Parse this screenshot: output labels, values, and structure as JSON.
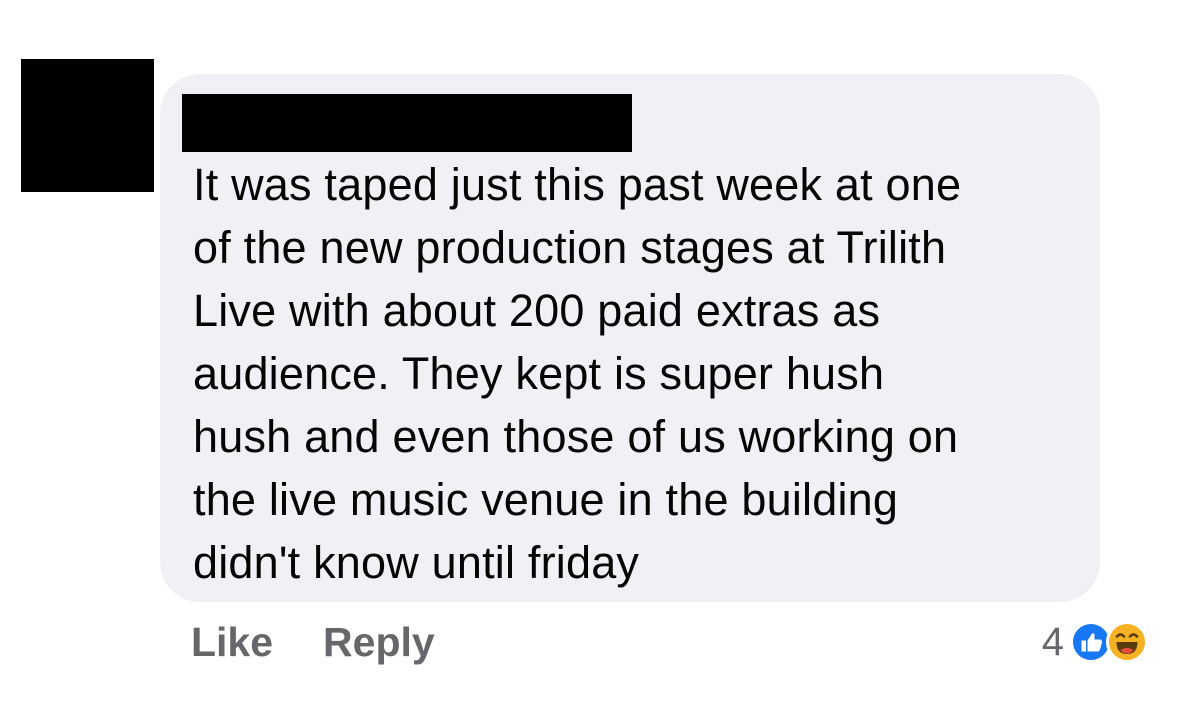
{
  "comment": {
    "text": "It was taped just this past week at one\nof the new production stages at Trilith\nLive with about 200 paid extras as\naudience.   They kept is super hush\nhush and even those of us working on\nthe live music venue in the building\ndidn't know until friday"
  },
  "actions": {
    "like_label": "Like",
    "reply_label": "Reply"
  },
  "reactions": {
    "count": "4",
    "icons": [
      "like-icon",
      "haha-icon"
    ]
  },
  "colors": {
    "bubble_background": "#f0f1f5",
    "text": "#050505",
    "secondary_text": "#65676b",
    "like_blue": "#1877f2",
    "haha_yellow": "#f7b125",
    "redaction": "#000000"
  }
}
